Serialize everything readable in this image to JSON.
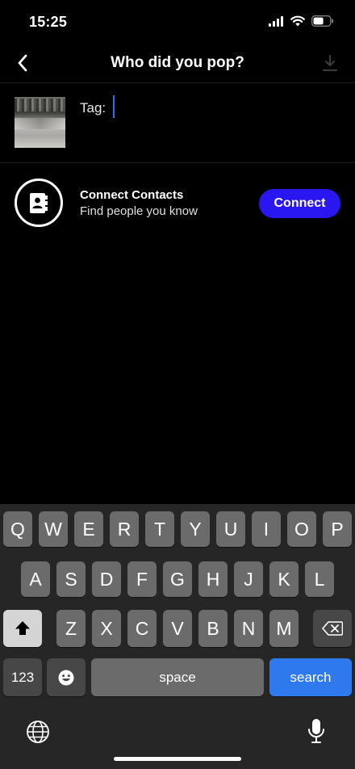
{
  "status": {
    "time": "15:25"
  },
  "nav": {
    "title": "Who did you pop?"
  },
  "tag": {
    "label": "Tag:"
  },
  "contacts": {
    "title": "Connect Contacts",
    "subtitle": "Find people you know",
    "button": "Connect"
  },
  "keyboard": {
    "row1": [
      "Q",
      "W",
      "E",
      "R",
      "T",
      "Y",
      "U",
      "I",
      "O",
      "P"
    ],
    "row2": [
      "A",
      "S",
      "D",
      "F",
      "G",
      "H",
      "J",
      "K",
      "L"
    ],
    "row3": [
      "Z",
      "X",
      "C",
      "V",
      "B",
      "N",
      "M"
    ],
    "numbers_key": "123",
    "space_key": "space",
    "action_key": "search"
  },
  "colors": {
    "accent": "#2a16f0",
    "cursor": "#2f6cf6",
    "search_key": "#2f79ee"
  }
}
